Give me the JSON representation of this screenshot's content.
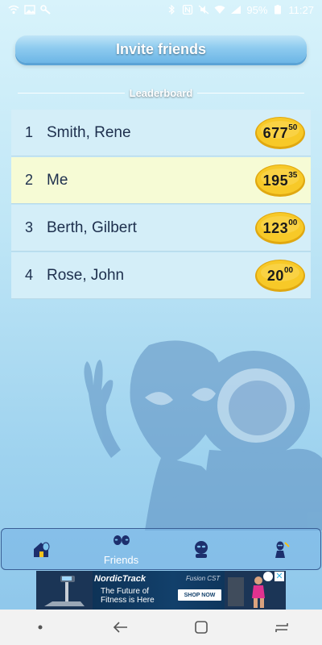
{
  "status_bar": {
    "battery": "95%",
    "time": "11:27",
    "left_icons": [
      "wifi-call-icon",
      "image-icon",
      "wrench-icon"
    ],
    "right_icons": [
      "bluetooth-icon",
      "nfc-icon",
      "mute-icon",
      "wifi-icon",
      "signal-icon",
      "battery-icon"
    ]
  },
  "header": {
    "invite_label": "Invite friends"
  },
  "leaderboard": {
    "title": "Leaderboard",
    "rows": [
      {
        "rank": "1",
        "name": "Smith, Rene",
        "score": "677",
        "fraction": "50",
        "is_me": false
      },
      {
        "rank": "2",
        "name": "Me",
        "score": "195",
        "fraction": "35",
        "is_me": true
      },
      {
        "rank": "3",
        "name": "Berth, Gilbert",
        "score": "123",
        "fraction": "00",
        "is_me": false
      },
      {
        "rank": "4",
        "name": "Rose, John",
        "score": "20",
        "fraction": "00",
        "is_me": false
      }
    ]
  },
  "bottom_nav": {
    "items": [
      {
        "icon": "home-alien-icon",
        "label": ""
      },
      {
        "icon": "friends-alien-icon",
        "label": "Friends",
        "active": true
      },
      {
        "icon": "profile-alien-icon",
        "label": ""
      },
      {
        "icon": "settings-alien-icon",
        "label": ""
      }
    ]
  },
  "ad": {
    "brand": "NordicTrack",
    "model": "Fusion CST",
    "tagline": "The Future of Fitness is Here",
    "cta": "SHOP NOW",
    "close": "✕"
  },
  "colors": {
    "row_default": "#d4eef8",
    "row_me": "#f6fbd5",
    "coin": "#f4c21c",
    "text_dark": "#1d2f4d",
    "nav_border": "#3a5f95"
  }
}
